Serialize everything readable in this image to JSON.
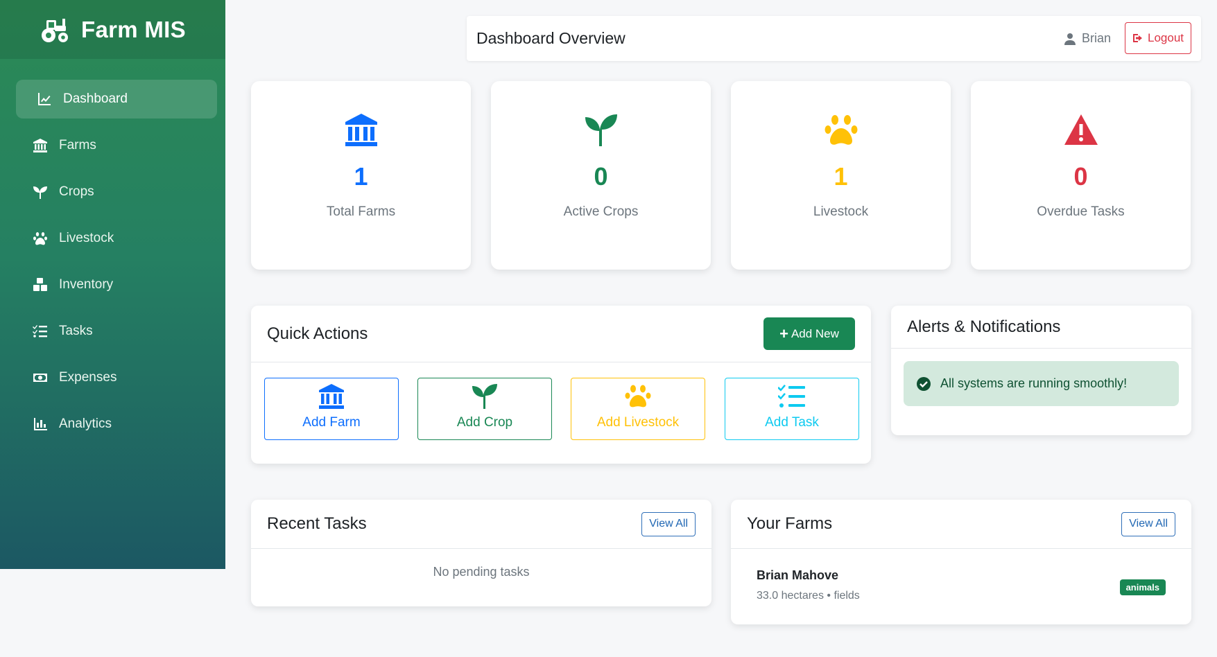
{
  "app": {
    "name": "Farm MIS"
  },
  "sidebar": {
    "items": [
      {
        "label": "Dashboard",
        "icon": "chart-line-icon",
        "active": true
      },
      {
        "label": "Farms",
        "icon": "bank-icon"
      },
      {
        "label": "Crops",
        "icon": "seedling-icon"
      },
      {
        "label": "Livestock",
        "icon": "paw-icon"
      },
      {
        "label": "Inventory",
        "icon": "boxes-icon"
      },
      {
        "label": "Tasks",
        "icon": "list-check-icon"
      },
      {
        "label": "Expenses",
        "icon": "money-bill-icon"
      },
      {
        "label": "Analytics",
        "icon": "bar-chart-icon"
      }
    ]
  },
  "header": {
    "title": "Dashboard Overview",
    "user": "Brian",
    "logout_label": "Logout"
  },
  "stats": [
    {
      "value": "1",
      "label": "Total Farms",
      "color": "#0d6efd",
      "icon": "bank-icon"
    },
    {
      "value": "0",
      "label": "Active Crops",
      "color": "#198754",
      "icon": "seedling-icon"
    },
    {
      "value": "1",
      "label": "Livestock",
      "color": "#ffc107",
      "icon": "paw-icon"
    },
    {
      "value": "0",
      "label": "Overdue Tasks",
      "color": "#dc3545",
      "icon": "warning-icon"
    }
  ],
  "quick_actions": {
    "title": "Quick Actions",
    "add_new_label": "Add New",
    "buttons": [
      {
        "label": "Add Farm",
        "color": "#0d6efd",
        "icon": "bank-icon"
      },
      {
        "label": "Add Crop",
        "color": "#198754",
        "icon": "seedling-icon"
      },
      {
        "label": "Add Livestock",
        "color": "#ffc107",
        "icon": "paw-icon"
      },
      {
        "label": "Add Task",
        "color": "#0dcaf0",
        "icon": "list-check-icon"
      }
    ]
  },
  "alerts": {
    "title": "Alerts & Notifications",
    "message": "All systems are running smoothly!"
  },
  "recent_tasks": {
    "title": "Recent Tasks",
    "view_all_label": "View All",
    "empty_text": "No pending tasks"
  },
  "your_farms": {
    "title": "Your Farms",
    "view_all_label": "View All",
    "farms": [
      {
        "name": "Brian Mahove",
        "details": "33.0 hectares • fields",
        "badge": "animals"
      }
    ]
  }
}
